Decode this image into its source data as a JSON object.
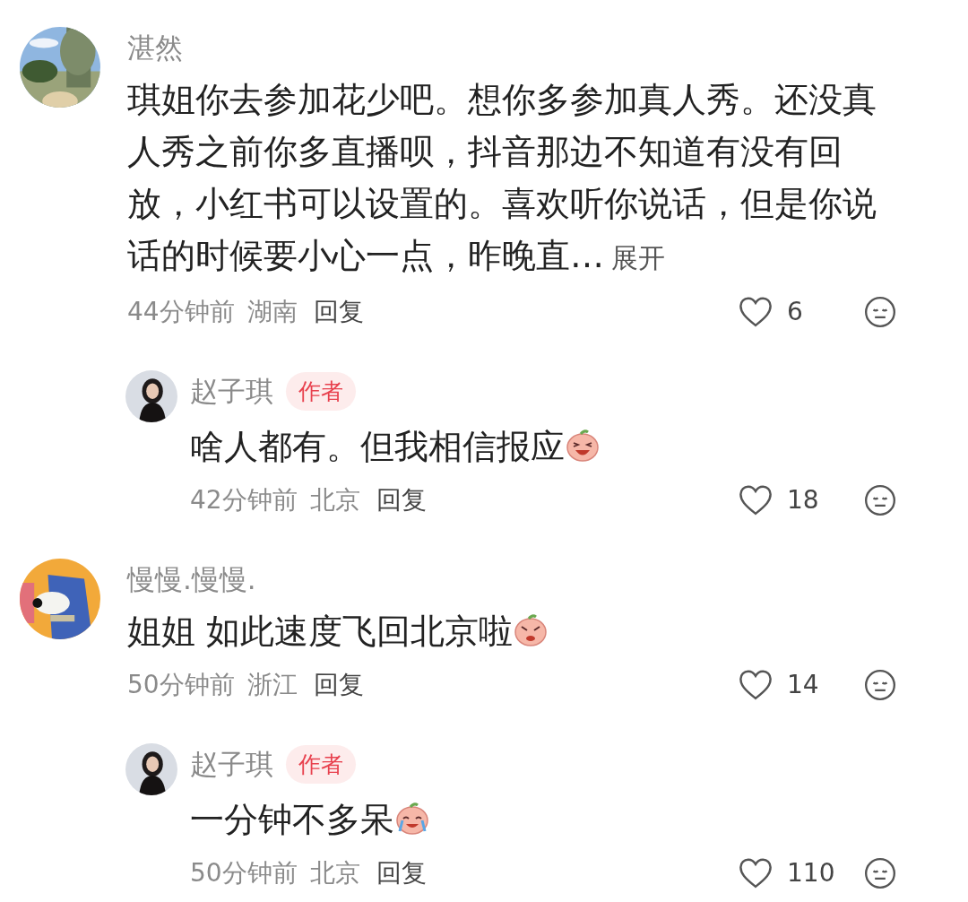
{
  "comments": [
    {
      "author": "湛然",
      "text": "琪姐你去参加花少吧。想你多参加真人秀。还没真人秀之前你多直播呗，抖音那边不知道有没有回放，小红书可以设置的。喜欢听你说话，但是你说话的时候要小心一点，昨晚直…",
      "expand": "展开",
      "time": "44分钟前",
      "location": "湖南",
      "reply": "回复",
      "likes": "6",
      "replies": [
        {
          "author": "赵子琪",
          "badge": "作者",
          "text": "啥人都有。但我相信报应",
          "sticker": true,
          "time": "42分钟前",
          "location": "北京",
          "reply": "回复",
          "likes": "18"
        }
      ]
    },
    {
      "author": "慢慢.慢慢.",
      "text": "姐姐 如此速度飞回北京啦",
      "sticker": true,
      "time": "50分钟前",
      "location": "浙江",
      "reply": "回复",
      "likes": "14",
      "replies": [
        {
          "author": "赵子琪",
          "badge": "作者",
          "text": "一分钟不多呆",
          "sticker": true,
          "time": "50分钟前",
          "location": "北京",
          "reply": "回复",
          "likes": "110"
        }
      ]
    }
  ]
}
